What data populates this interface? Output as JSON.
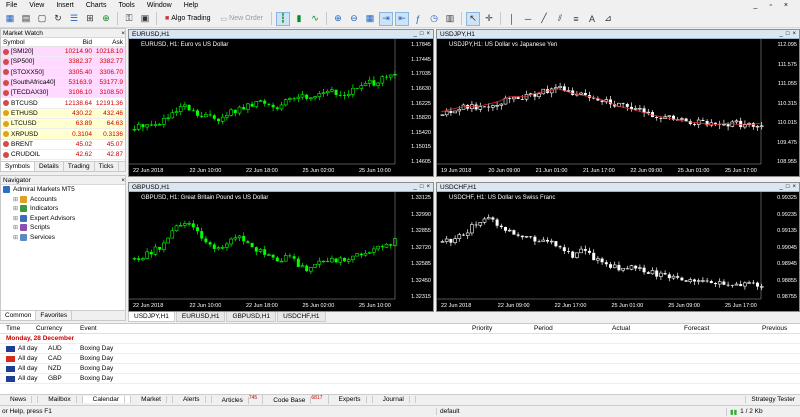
{
  "menu": [
    "File",
    "View",
    "Insert",
    "Charts",
    "Tools",
    "Window",
    "Help"
  ],
  "toolbar": {
    "algo_label": "Algo Trading",
    "new_order_label": "New Order"
  },
  "market_watch": {
    "title": "Market Watch",
    "headers": {
      "symbol": "Symbol",
      "bid": "Bid",
      "ask": "Ask"
    },
    "rows": [
      {
        "symbol": "[SMI20]",
        "bid": "10214.90",
        "ask": "10218.10",
        "bg": "#ffd9ff",
        "dot": "#d24a4a"
      },
      {
        "symbol": "[SP500]",
        "bid": "3382.37",
        "ask": "3382.77",
        "bg": "#ffd9ff",
        "dot": "#d24a4a"
      },
      {
        "symbol": "[STOXX50]",
        "bid": "3305.40",
        "ask": "3306.70",
        "bg": "#ffd9ff",
        "dot": "#d24a4a"
      },
      {
        "symbol": "[SouthAfrica40]",
        "bid": "53163.9",
        "ask": "53177.9",
        "bg": "#ffd9ff",
        "dot": "#d24a4a"
      },
      {
        "symbol": "[TECDAX30]",
        "bid": "3106.10",
        "ask": "3108.50",
        "bg": "#ffd9ff",
        "dot": "#d24a4a"
      },
      {
        "symbol": "BTCUSD",
        "bid": "12138.64",
        "ask": "12191.36",
        "bg": "#ffffff",
        "dot": "#d24a4a"
      },
      {
        "symbol": "ETHUSD",
        "bid": "430.22",
        "ask": "432.46",
        "bg": "#ffffd0",
        "dot": "#e0a020"
      },
      {
        "symbol": "LTCUSD",
        "bid": "63.89",
        "ask": "64.63",
        "bg": "#ffffd0",
        "dot": "#e0a020"
      },
      {
        "symbol": "XRPUSD",
        "bid": "0.3104",
        "ask": "0.3136",
        "bg": "#ffffd0",
        "dot": "#e0a020"
      },
      {
        "symbol": "BRENT",
        "bid": "45.02",
        "ask": "45.07",
        "bg": "#ffffff",
        "dot": "#d24a4a"
      },
      {
        "symbol": "CRUDOIL",
        "bid": "42.62",
        "ask": "42.87",
        "bg": "#ffffff",
        "dot": "#d24a4a"
      }
    ],
    "tabs": [
      "Symbols",
      "Details",
      "Trading",
      "Ticks"
    ]
  },
  "navigator": {
    "title": "Navigator",
    "items": [
      {
        "label": "Admiral Markets MT5",
        "level": 0,
        "color": "#2f6fc1"
      },
      {
        "label": "Accounts",
        "level": 1,
        "color": "#e0a020"
      },
      {
        "label": "Indicators",
        "level": 1,
        "color": "#3c9a3c"
      },
      {
        "label": "Expert Advisors",
        "level": 1,
        "color": "#3b6fb6"
      },
      {
        "label": "Scripts",
        "level": 1,
        "color": "#8a4fb0"
      },
      {
        "label": "Services",
        "level": 1,
        "color": "#5a8abf"
      }
    ],
    "tabs": [
      "Common",
      "Favorites"
    ]
  },
  "charts": [
    {
      "title": "EURUSD,H1",
      "subtitle": "EURUSD, H1:  Euro vs US Dollar",
      "yticks": [
        "1.17845",
        "1.17445",
        "1.17035",
        "1.16630",
        "1.16225",
        "1.15820",
        "1.15420",
        "1.15015",
        "1.14605"
      ],
      "xticks": [
        "22 Jun 2018",
        "22 Jun 10:00",
        "22 Jun 18:00",
        "25 Jun 02:00",
        "25 Jun 10:00"
      ],
      "color": "#00ff00"
    },
    {
      "title": "USDJPY,H1",
      "subtitle": "USDJPY,H1:  US Dollar vs Japanese Yen",
      "yticks": [
        "112.095",
        "111.575",
        "111.055",
        "110.315",
        "110.015",
        "109.475",
        "108.955"
      ],
      "xticks": [
        "19 Jun 2018",
        "20 Jun 09:00",
        "21 Jun 01:00",
        "21 Jun 17:00",
        "22 Jun 09:00",
        "25 Jun 01:00",
        "25 Jun 17:00"
      ],
      "color": "#ffffff"
    },
    {
      "title": "GBPUSD,H1",
      "subtitle": "GBPUSD, H1:  Great Britain Pound vs US Dollar",
      "yticks": [
        "1.33125",
        "1.32990",
        "1.32855",
        "1.32720",
        "1.32585",
        "1.32450",
        "1.32315"
      ],
      "xticks": [
        "22 Jun 2018",
        "22 Jun 10:00",
        "22 Jun 18:00",
        "25 Jun 02:00",
        "25 Jun 10:00"
      ],
      "color": "#00ff00"
    },
    {
      "title": "USDCHF,H1",
      "subtitle": "USDCHF, H1:  US Dollar vs Swiss Franc",
      "yticks": [
        "0.99325",
        "0.99235",
        "0.99135",
        "0.99045",
        "0.98945",
        "0.98855",
        "0.98755"
      ],
      "xticks": [
        "22 Jun 2018",
        "22 Jun 09:00",
        "22 Jun 17:00",
        "25 Jun 01:00",
        "25 Jun 09:00",
        "25 Jun 17:00"
      ],
      "color": "#ffffff"
    }
  ],
  "chart_tabs": [
    "USDJPY,H1",
    "EURUSD,H1",
    "GBPUSD,H1",
    "USDCHF,H1"
  ],
  "calendar": {
    "headers": [
      "Time",
      "Currency",
      "Event",
      "Priority",
      "Period",
      "Actual",
      "Forecast",
      "Previous"
    ],
    "date_label": "Monday, 28 December",
    "rows": [
      {
        "time": "All day",
        "currency": "AUD",
        "event": "Boxing Day",
        "flag": "#1c3f94"
      },
      {
        "time": "All day",
        "currency": "CAD",
        "event": "Boxing Day",
        "flag": "#d52b1e"
      },
      {
        "time": "All day",
        "currency": "NZD",
        "event": "Boxing Day",
        "flag": "#1c3f94"
      },
      {
        "time": "All day",
        "currency": "GBP",
        "event": "Boxing Day",
        "flag": "#1c3f94"
      }
    ]
  },
  "toolbox_tabs": [
    {
      "label": "News",
      "badge": ""
    },
    {
      "label": "Mailbox",
      "badge": ""
    },
    {
      "label": "Calendar",
      "badge": ""
    },
    {
      "label": "Market",
      "badge": ""
    },
    {
      "label": "Alerts",
      "badge": ""
    },
    {
      "label": "Articles",
      "badge": "745"
    },
    {
      "label": "Code Base",
      "badge": "6817"
    },
    {
      "label": "Experts",
      "badge": ""
    },
    {
      "label": "Journal",
      "badge": ""
    }
  ],
  "strategy_tester": "Strategy Tester",
  "status": {
    "help": "or Help, press F1",
    "profile": "default",
    "traffic": "1 / 2 Kb"
  }
}
